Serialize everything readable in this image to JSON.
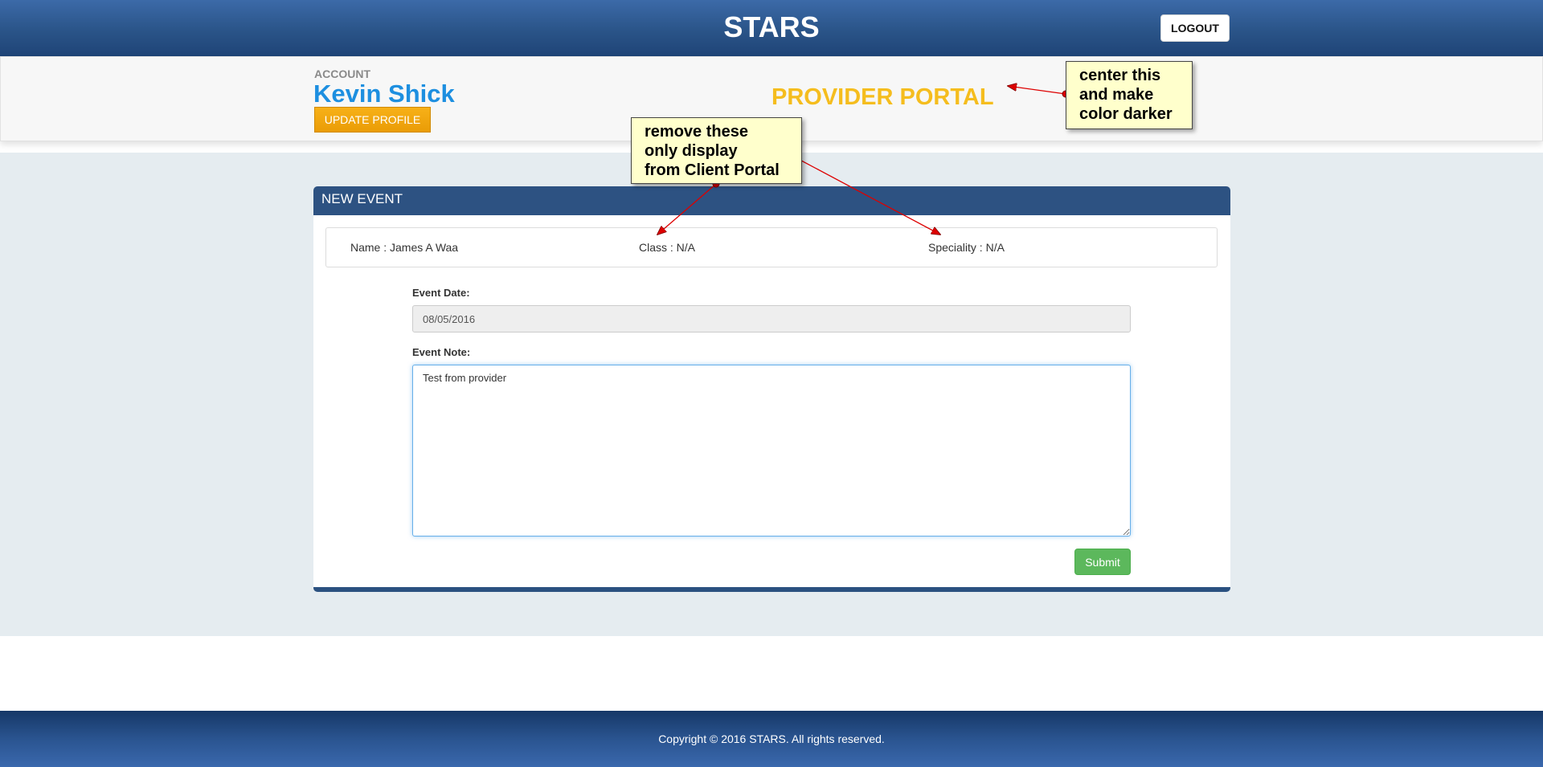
{
  "header": {
    "brand": "STARS",
    "logout_label": "LOGOUT"
  },
  "account": {
    "label": "ACCOUNT",
    "name": "Kevin Shick",
    "update_label": "UPDATE PROFILE",
    "portal_title": "PROVIDER PORTAL"
  },
  "panel": {
    "title": "NEW EVENT",
    "info": {
      "name": "Name : James A Waa",
      "class": "Class : N/A",
      "speciality": "Speciality : N/A"
    },
    "event_date_label": "Event Date:",
    "event_date_value": "08/05/2016",
    "event_note_label": "Event Note:",
    "event_note_value": "Test from provider",
    "submit_label": "Submit"
  },
  "footer": {
    "copyright": "Copyright © 2016 STARS. All rights reserved."
  },
  "annotations": {
    "note1": [
      "center this",
      "and make",
      "color darker"
    ],
    "note2": [
      "remove these",
      "only display",
      "from Client Portal"
    ]
  },
  "colors": {
    "header": "#2a5488",
    "portal_title": "#f5bd1e",
    "account_name": "#1d8fe0",
    "panel_header": "#2d5282",
    "submit": "#5cb85c",
    "annotation_bg": "#ffffcc",
    "arrow": "#dd0000"
  }
}
